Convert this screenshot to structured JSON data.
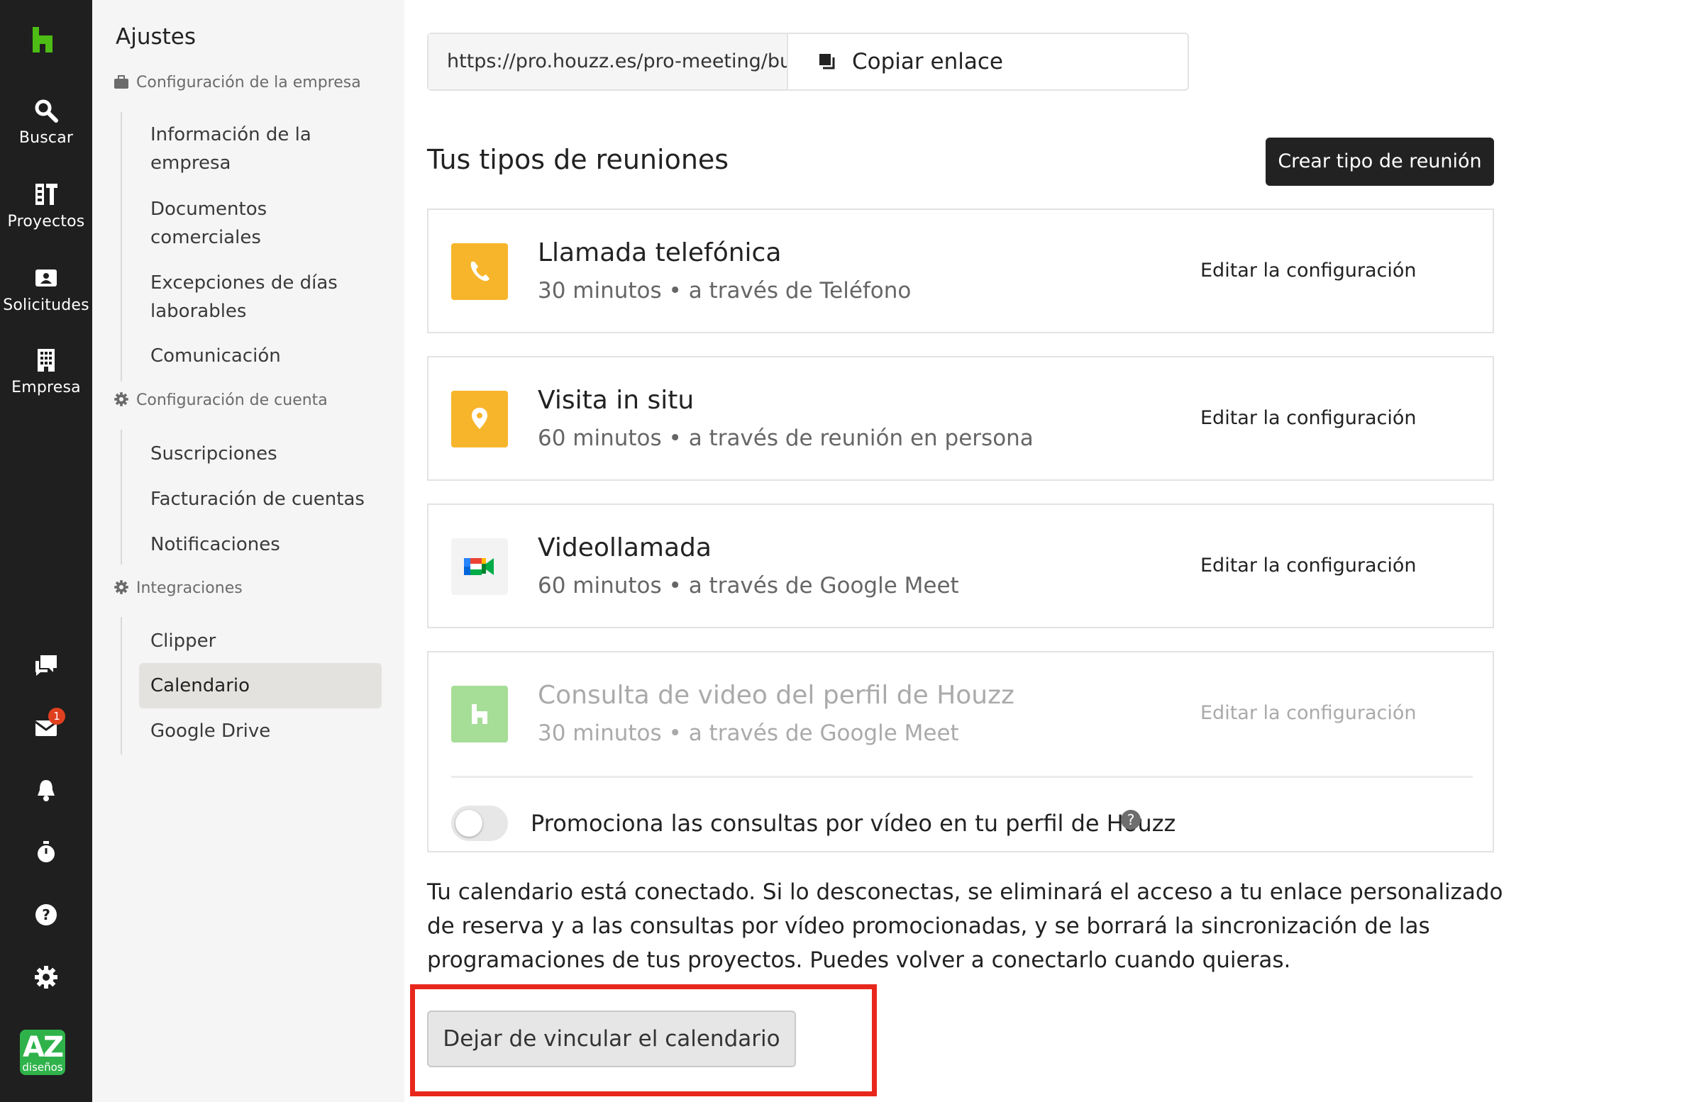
{
  "rail": {
    "items": [
      {
        "label": "Buscar",
        "icon": "search-icon"
      },
      {
        "label": "Proyectos",
        "icon": "projects-icon"
      },
      {
        "label": "Solicitudes",
        "icon": "requests-icon"
      },
      {
        "label": "Empresa",
        "icon": "building-icon"
      }
    ],
    "bottom_icons": [
      "chat-icon",
      "inbox-icon",
      "bell-icon",
      "timer-icon",
      "help-icon",
      "gear-icon"
    ],
    "inbox_badge": "1",
    "avatar": {
      "initials": "AZ",
      "caption": "diseños"
    },
    "brand_color": "#4dbc15"
  },
  "settings_nav": {
    "title": "Ajustes",
    "sections": [
      {
        "heading": "Configuración de la empresa",
        "icon": "briefcase-icon",
        "links": [
          {
            "line1": "Información de la",
            "line2": "empresa"
          },
          {
            "line1": "Documentos",
            "line2": "comerciales"
          },
          {
            "line1": "Excepciones de días",
            "line2": "laborables"
          },
          {
            "line1": "Comunicación",
            "line2": ""
          }
        ]
      },
      {
        "heading": "Configuración de cuenta",
        "icon": "gear-icon",
        "links": [
          "Suscripciones",
          "Facturación de cuentas",
          "Notificaciones"
        ]
      },
      {
        "heading": "Integraciones",
        "icon": "gear-icon",
        "links": [
          "Clipper",
          "Calendario",
          "Google Drive"
        ]
      }
    ],
    "active": "Calendario"
  },
  "main": {
    "booking_url": "https://pro.houzz.es/pro-meeting/bu",
    "copy_label": "Copiar enlace",
    "heading": "Tus tipos de reuniones",
    "create_label": "Crear tipo de reunión",
    "meeting_types": [
      {
        "title": "Llamada telefónica",
        "duration": "30 minutos",
        "via": "a través de Teléfono",
        "edit": "Editar la configuración",
        "icon": "phone-icon",
        "color": "#f7b52c"
      },
      {
        "title": "Visita in situ",
        "duration": "60 minutos",
        "via": "a través de reunión en persona",
        "edit": "Editar la configuración",
        "icon": "location-pin-icon",
        "color": "#f7b52c"
      },
      {
        "title": "Videollamada",
        "duration": "60 minutos",
        "via": "a través de Google Meet",
        "edit": "Editar la configuración",
        "icon": "google-meet-icon",
        "color": "#f3f3f3"
      },
      {
        "title": "Consulta de video del perfil de Houzz",
        "duration": "30 minutos",
        "via": "a través de Google Meet",
        "edit": "Editar la configuración",
        "icon": "houzz-icon",
        "color": "#a6dd97"
      }
    ],
    "promo_text": "Promociona las consultas por vídeo en tu perfil de Houzz",
    "promo_toggle_on": false,
    "help_glyph": "?",
    "notice": "Tu calendario está conectado. Si lo desconectas, se eliminará el acceso a tu enlace personalizado de reserva y a las consultas por vídeo promocionadas, y se borrará la sincronización de las programaciones de tus proyectos. Puedes volver a conectarlo cuando quieras.",
    "unlink_label": "Dejar de vincular el calendario",
    "highlight_color": "#e8271c"
  }
}
